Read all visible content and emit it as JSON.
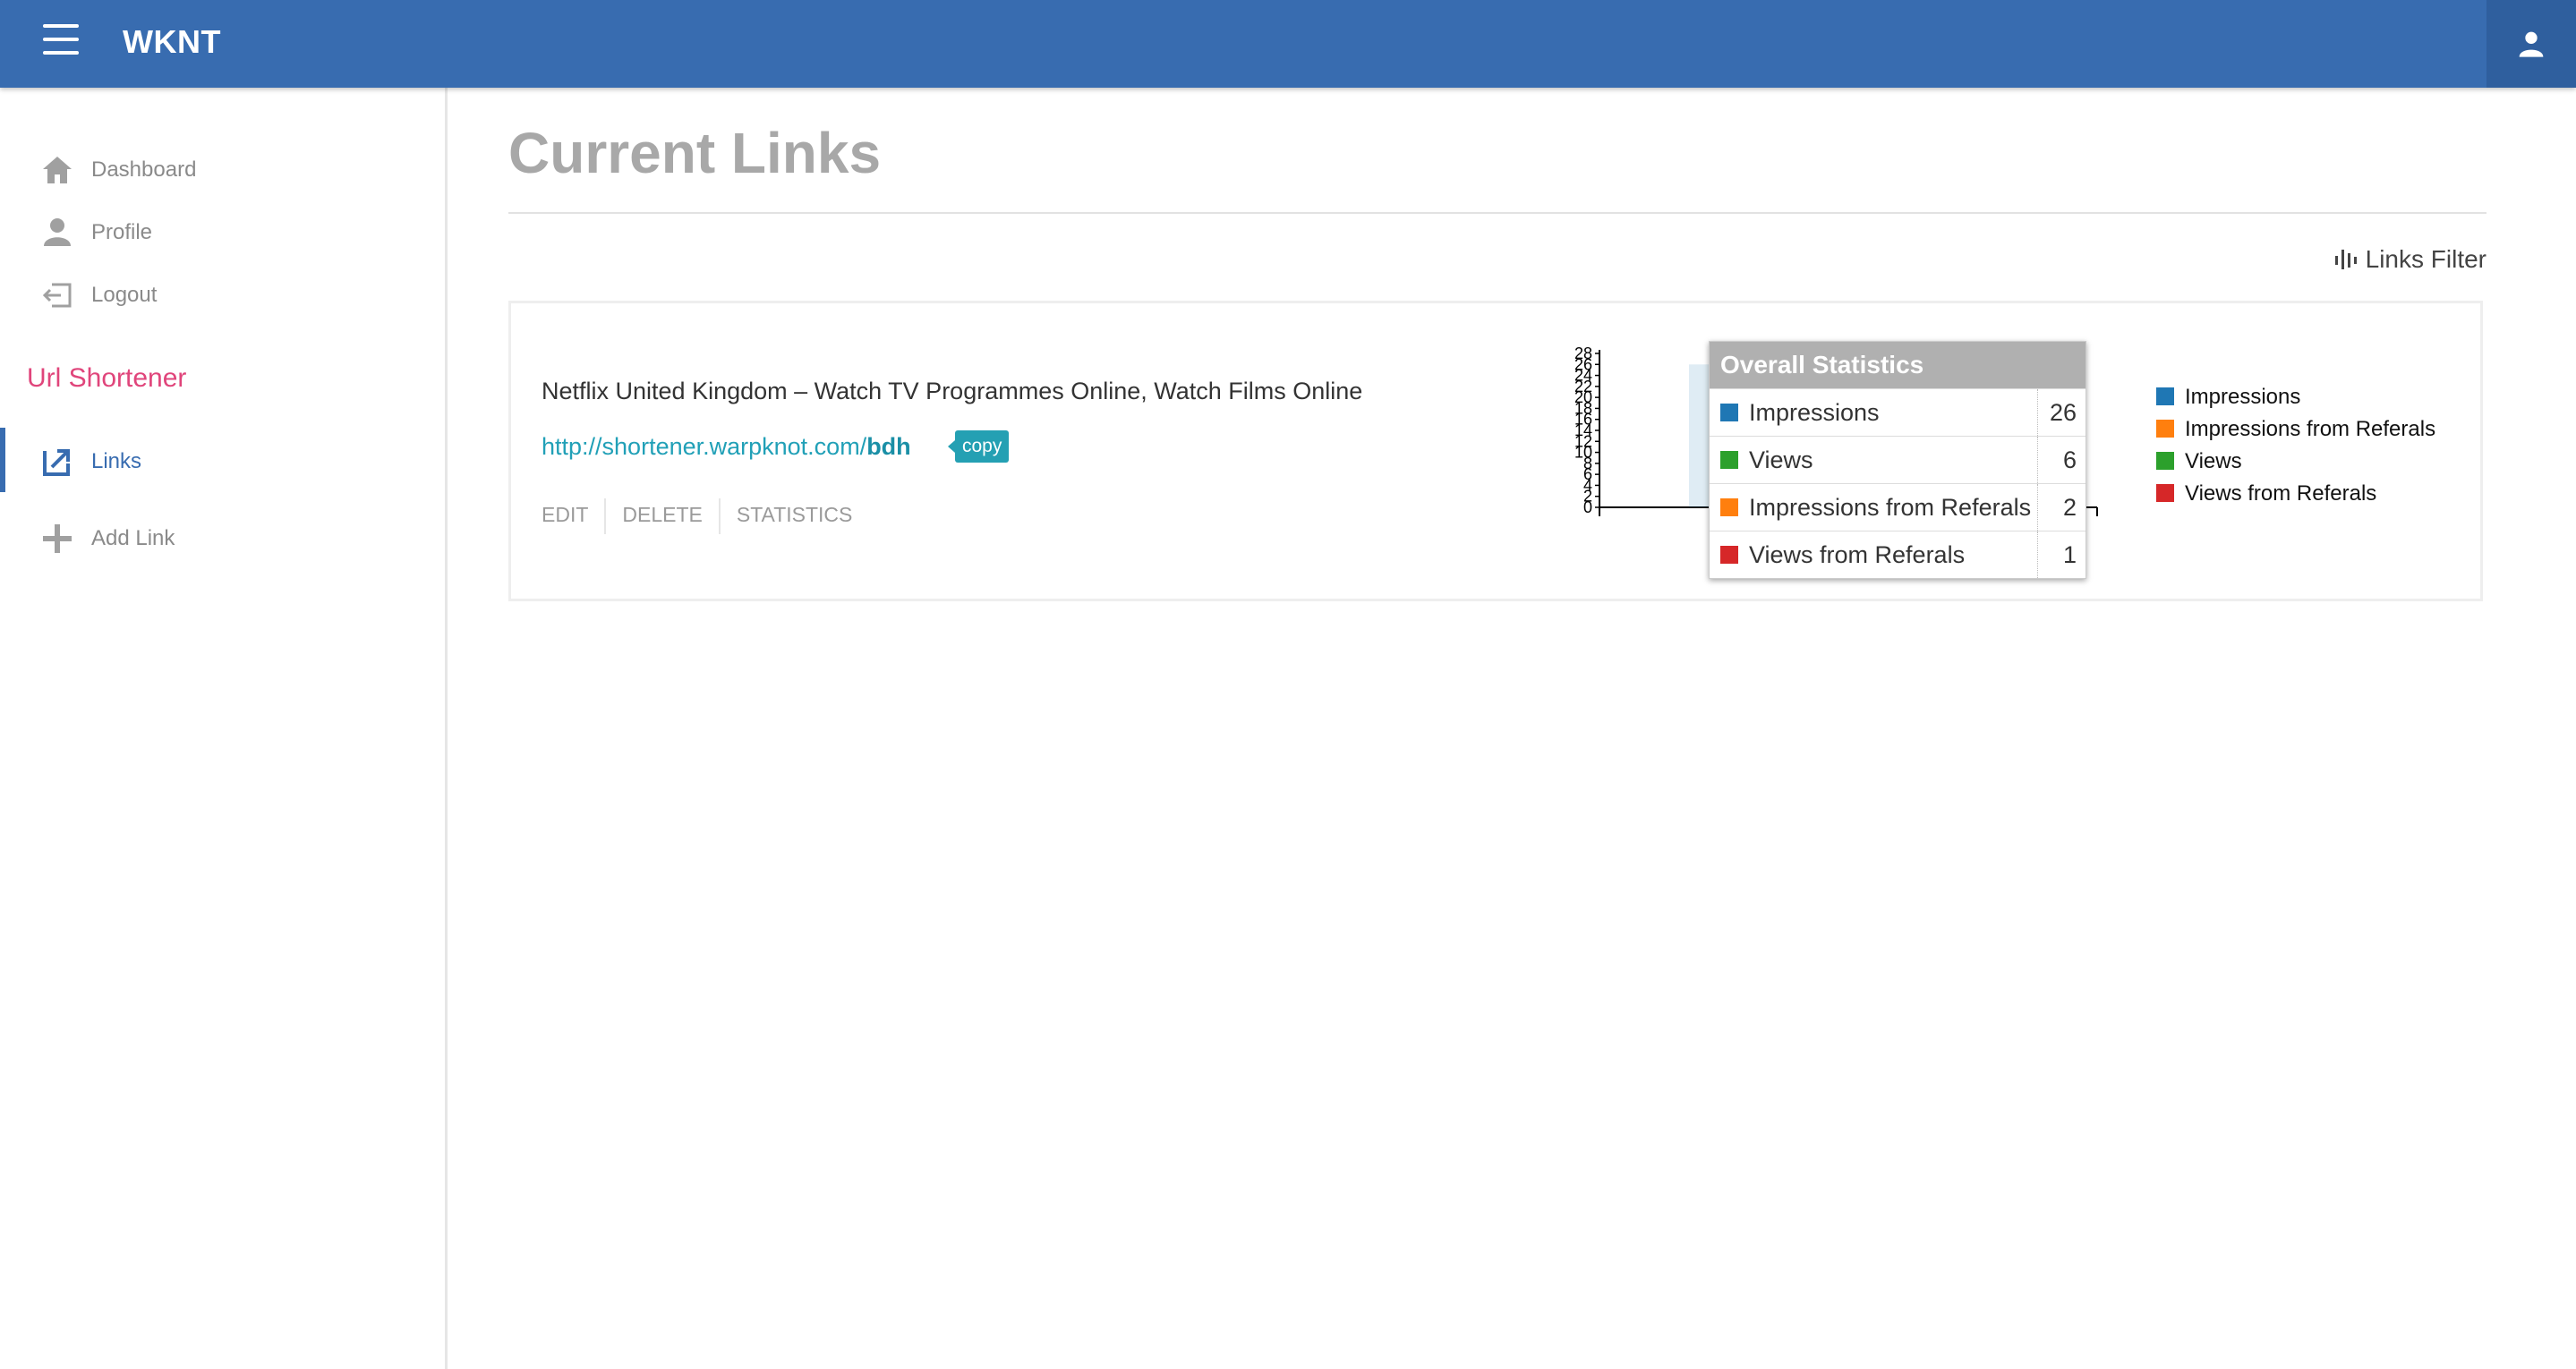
{
  "app": {
    "brand": "WKNT"
  },
  "sidebar": {
    "items": [
      {
        "label": "Dashboard",
        "icon": "home-icon"
      },
      {
        "label": "Profile",
        "icon": "person-icon"
      },
      {
        "label": "Logout",
        "icon": "logout-icon"
      }
    ],
    "section_title": "Url Shortener",
    "section_items": [
      {
        "label": "Links",
        "icon": "external-link-icon",
        "active": true
      },
      {
        "label": "Add Link",
        "icon": "plus-icon",
        "active": false
      }
    ]
  },
  "main": {
    "title": "Current Links",
    "filter_label": "Links Filter",
    "link": {
      "title": "Netflix United Kingdom – Watch TV Programmes Online, Watch Films Online",
      "url_base": "http://shortener.warpknot.com/",
      "url_slug": "bdh",
      "copy_label": "copy",
      "actions": {
        "edit": "EDIT",
        "delete": "DELETE",
        "statistics": "STATISTICS"
      }
    }
  },
  "tooltip": {
    "title": "Overall Statistics",
    "rows": [
      {
        "name": "Impressions",
        "value": "26",
        "color": "#1f77b4"
      },
      {
        "name": "Views",
        "value": "6",
        "color": "#2ca02c"
      },
      {
        "name": "Impressions from Referals",
        "value": "2",
        "color": "#ff7f0e"
      },
      {
        "name": "Views from Referals",
        "value": "1",
        "color": "#d62728"
      }
    ]
  },
  "chart_data": {
    "type": "bar",
    "categories": [
      "Overall Statistics"
    ],
    "series": [
      {
        "name": "Impressions",
        "values": [
          26
        ],
        "color": "#1f77b4"
      },
      {
        "name": "Impressions from Referals",
        "values": [
          2
        ],
        "color": "#ff7f0e"
      },
      {
        "name": "Views",
        "values": [
          6
        ],
        "color": "#2ca02c"
      },
      {
        "name": "Views from Referals",
        "values": [
          1
        ],
        "color": "#d62728"
      }
    ],
    "yticks": [
      "0",
      "2",
      "4",
      "6",
      "8",
      "10",
      "12",
      "14",
      "16",
      "18",
      "20",
      "22",
      "24",
      "26",
      "28"
    ],
    "ylim": [
      0,
      28
    ],
    "legend": "right"
  }
}
